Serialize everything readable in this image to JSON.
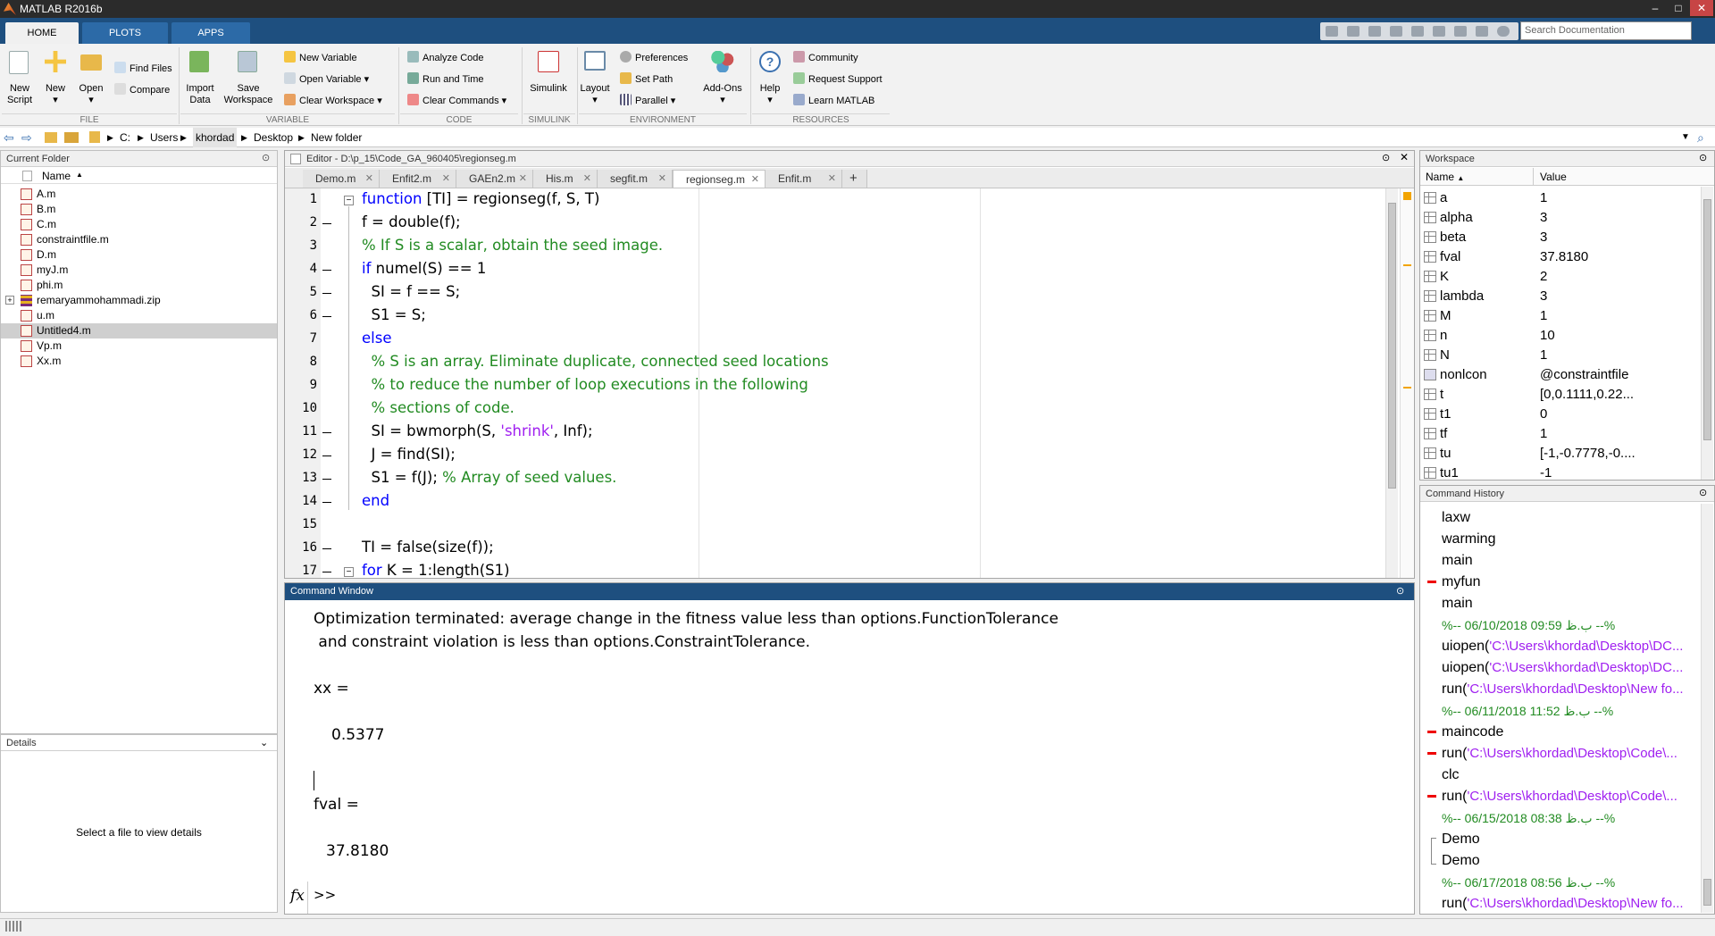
{
  "app": {
    "title": "MATLAB R2016b"
  },
  "main_tabs": [
    {
      "label": "HOME"
    },
    {
      "label": "PLOTS"
    },
    {
      "label": "APPS"
    }
  ],
  "search": {
    "placeholder": "Search Documentation"
  },
  "ribbon": {
    "file": {
      "new_script": "New",
      "new_script2": "Script",
      "new": "New",
      "open": "Open",
      "find_files": "Find Files",
      "compare": "Compare",
      "group": "FILE"
    },
    "variable": {
      "import": "Import",
      "import2": "Data",
      "save": "Save",
      "save2": "Workspace",
      "new_variable": "New Variable",
      "open_variable": "Open Variable",
      "clear_workspace": "Clear Workspace",
      "group": "VARIABLE"
    },
    "code": {
      "analyze": "Analyze Code",
      "run_time": "Run and Time",
      "clear_commands": "Clear Commands",
      "group": "CODE"
    },
    "simulink": {
      "label": "Simulink",
      "group": "SIMULINK"
    },
    "environment": {
      "layout": "Layout",
      "preferences": "Preferences",
      "set_path": "Set Path",
      "parallel": "Parallel",
      "addons": "Add-Ons",
      "group": "ENVIRONMENT"
    },
    "resources": {
      "help": "Help",
      "community": "Community",
      "request_support": "Request Support",
      "learn": "Learn MATLAB",
      "group": "RESOURCES"
    }
  },
  "address": {
    "crumbs": [
      "C:",
      "Users",
      "khordad",
      "Desktop",
      "New folder"
    ]
  },
  "current_folder": {
    "title": "Current Folder",
    "column": "Name",
    "files": [
      "A.m",
      "B.m",
      "C.m",
      "constraintfile.m",
      "D.m",
      "myJ.m",
      "phi.m",
      "remaryammohammadi.zip",
      "u.m",
      "Untitled4.m",
      "Vp.m",
      "Xx.m"
    ],
    "selected": "Untitled4.m"
  },
  "details": {
    "title": "Details",
    "message": "Select a file to view details"
  },
  "editor": {
    "title": "Editor - D:\\p_15\\Code_GA_960405\\regionseg.m",
    "tabs": [
      "Demo.m",
      "Enfit2.m",
      "GAEn2.m",
      "His.m",
      "segfit.m",
      "regionseg.m",
      "Enfit.m"
    ],
    "active_tab": "regionseg.m",
    "add_tab": "+",
    "line_numbers": [
      "1",
      "2",
      "3",
      "4",
      "5",
      "6",
      "7",
      "8",
      "9",
      "10",
      "11",
      "12",
      "13",
      "14",
      "15",
      "16",
      "17"
    ],
    "lines": {
      "l1a": "function",
      "l1b": " [TI] = regionseg(f, S, T)",
      "l2": "f = double(f);",
      "l3": "% If S is a scalar, obtain the seed image.",
      "l4a": "if",
      "l4b": " numel(S) == 1",
      "l5": "  SI = f == S;",
      "l6": "  S1 = S;",
      "l7": "else",
      "l8": "  % S is an array. Eliminate duplicate, connected seed locations",
      "l9": "  % to reduce the number of loop executions in the following",
      "l10": "  % sections of code.",
      "l11a": "  SI = bwmorph(S, ",
      "l11b": "'shrink'",
      "l11c": ", Inf);",
      "l12": "  J = find(SI);",
      "l13a": "  S1 = f(J); ",
      "l13b": "% Array of seed values.",
      "l14": "end",
      "l15": "",
      "l16": "TI = false(size(f));",
      "l17a": "for",
      "l17b": " K = 1:length(S1)"
    }
  },
  "command_window": {
    "title": "Command Window",
    "line1": "Optimization terminated: average change in the fitness value less than options.FunctionTolerance",
    "line2": " and constraint violation is less than options.ConstraintTolerance.",
    "xx_label": "xx =",
    "xx_value": "0.5377",
    "fval_label": "fval =",
    "fval_value": "37.8180",
    "fx": "fx",
    "prompt": ">>"
  },
  "workspace": {
    "title": "Workspace",
    "col_name": "Name",
    "col_value": "Value",
    "vars": [
      {
        "name": "a",
        "value": "1"
      },
      {
        "name": "alpha",
        "value": "3"
      },
      {
        "name": "beta",
        "value": "3"
      },
      {
        "name": "fval",
        "value": "37.8180"
      },
      {
        "name": "K",
        "value": "2"
      },
      {
        "name": "lambda",
        "value": "3"
      },
      {
        "name": "M",
        "value": "1"
      },
      {
        "name": "n",
        "value": "10"
      },
      {
        "name": "N",
        "value": "1"
      },
      {
        "name": "nonlcon",
        "value": "@constraintfile"
      },
      {
        "name": "t",
        "value": "[0,0.1111,0.22..."
      },
      {
        "name": "t1",
        "value": "0"
      },
      {
        "name": "tf",
        "value": "1"
      },
      {
        "name": "tu",
        "value": "[-1,-0.7778,-0...."
      },
      {
        "name": "tu1",
        "value": "-1"
      }
    ]
  },
  "history": {
    "title": "Command History",
    "items": [
      {
        "cmd": "laxw"
      },
      {
        "cmd": "warming"
      },
      {
        "cmd": "main"
      },
      {
        "cmd": "myfun",
        "mark": true
      },
      {
        "cmd": "main"
      },
      {
        "sep": "%-- ب.ظ 09:59 06/10/2018 --%"
      },
      {
        "cmd": "uiopen(",
        "path": "'C:\\Users\\khordad\\Desktop\\DC..."
      },
      {
        "cmd": "uiopen(",
        "path": "'C:\\Users\\khordad\\Desktop\\DC..."
      },
      {
        "cmd": "run(",
        "path": "'C:\\Users\\khordad\\Desktop\\New fo..."
      },
      {
        "sep": "%-- ب.ظ 11:52 06/11/2018 --%"
      },
      {
        "cmd": "maincode",
        "mark": true
      },
      {
        "cmd": "run(",
        "path": "'C:\\Users\\khordad\\Desktop\\Code\\...",
        "mark": true
      },
      {
        "cmd": "clc"
      },
      {
        "cmd": "run(",
        "path": "'C:\\Users\\khordad\\Desktop\\Code\\...",
        "mark": true
      },
      {
        "sep": "%-- ب.ظ 08:38 06/15/2018 --%"
      },
      {
        "cmd": "Demo"
      },
      {
        "cmd": "Demo"
      },
      {
        "sep": "%-- ب.ظ 08:56 06/17/2018 --%"
      },
      {
        "cmd": "run(",
        "path": "'C:\\Users\\khordad\\Desktop\\New fo..."
      }
    ]
  },
  "colors": {
    "accent": "#1e4f7f",
    "keyword": "#0000ff",
    "comment": "#228b22",
    "string": "#a020f0"
  }
}
